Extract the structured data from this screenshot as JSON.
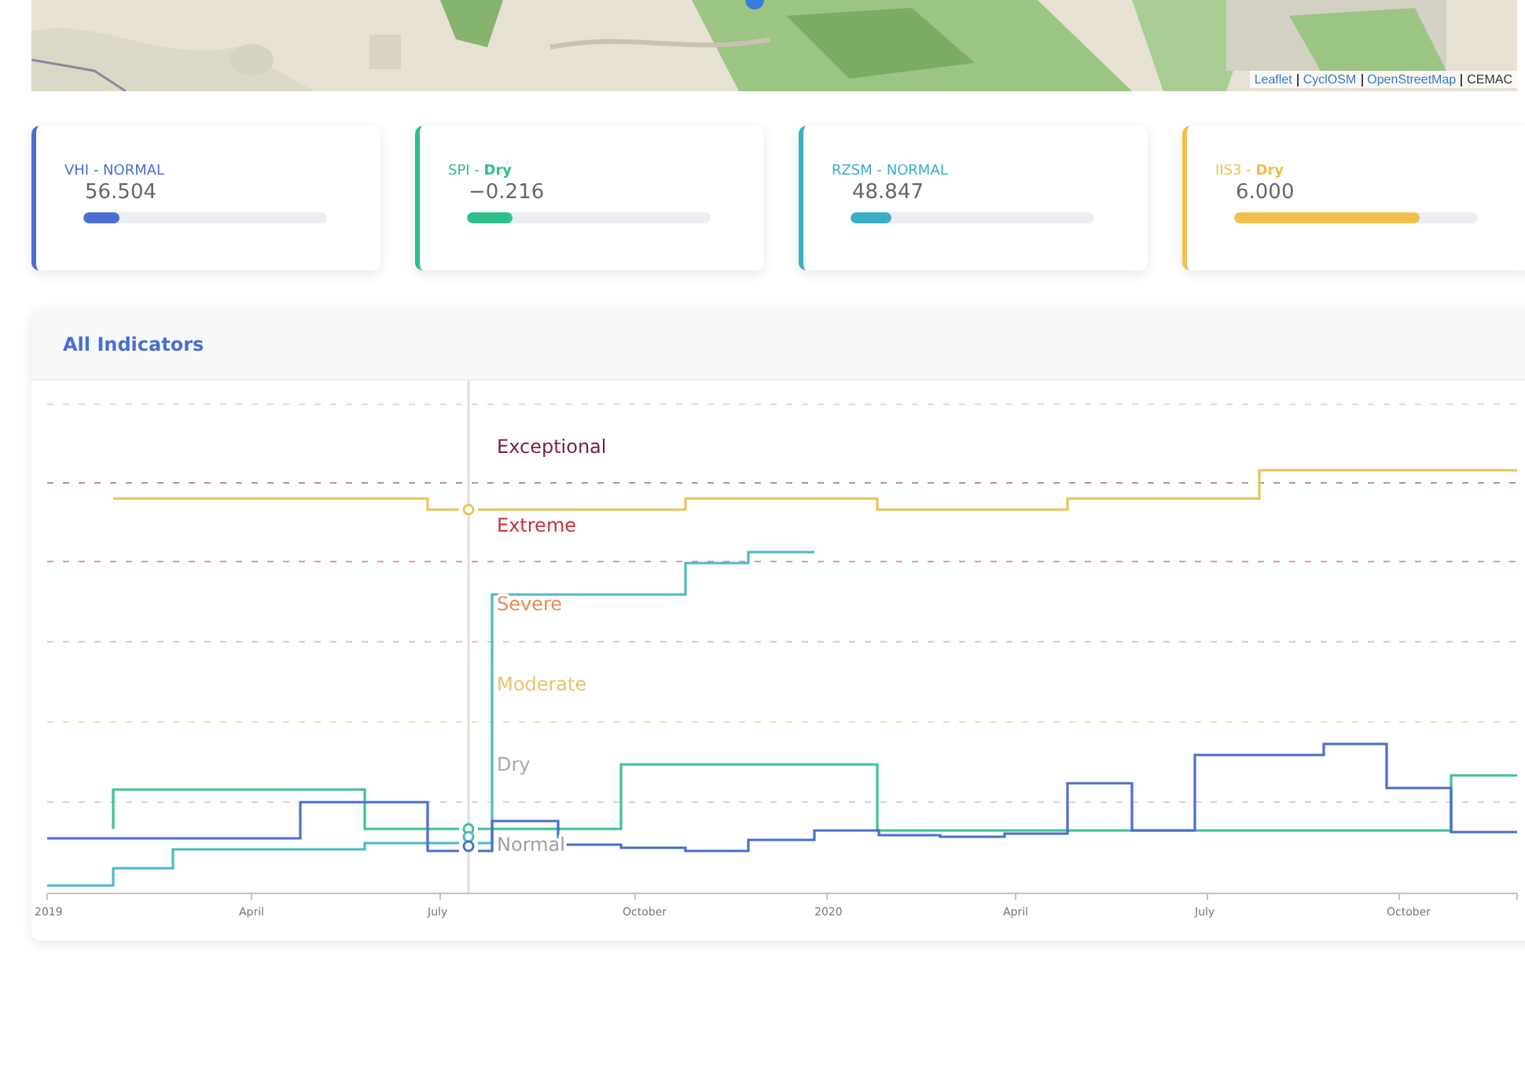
{
  "map": {
    "kind": "picture",
    "attribution": [
      {
        "text": "Leaflet",
        "link": true
      },
      {
        "text": "CyclOSM",
        "link": true
      },
      {
        "text": "OpenStreetMap",
        "link": true
      },
      {
        "text": "CEMAC",
        "link": false
      }
    ]
  },
  "cards": [
    {
      "label": "VHI - NORMAL",
      "value": "56.504",
      "level": 0.15,
      "color": "#4a6fd0"
    },
    {
      "label": "SPI - **Dry**",
      "value": "−0.216",
      "level": 0.19,
      "color": "#2fbf8a"
    },
    {
      "label": "RZSM - NORMAL",
      "value": "48.847",
      "level": 0.17,
      "color": "#3ab0c4"
    },
    {
      "label": "IIS3 - **Dry**",
      "value": "6.000",
      "level": 0.76,
      "color": "#efc04c"
    }
  ],
  "chart": {
    "title": "All Indicators",
    "bands": [
      {
        "label": "Exceptional",
        "color": "#7a1f33"
      },
      {
        "label": "Extreme",
        "color": "#c8303f"
      },
      {
        "label": "Severe",
        "color": "#e88a55"
      },
      {
        "label": "Moderate",
        "color": "#e9c36c"
      },
      {
        "label": "Dry",
        "color": "#a8a8a8"
      },
      {
        "label": "Normal",
        "color": "#a0a0a0"
      }
    ],
    "x_ticks": [
      "2019",
      "April",
      "July",
      "October",
      "2020",
      "April",
      "July",
      "October"
    ]
  }
}
